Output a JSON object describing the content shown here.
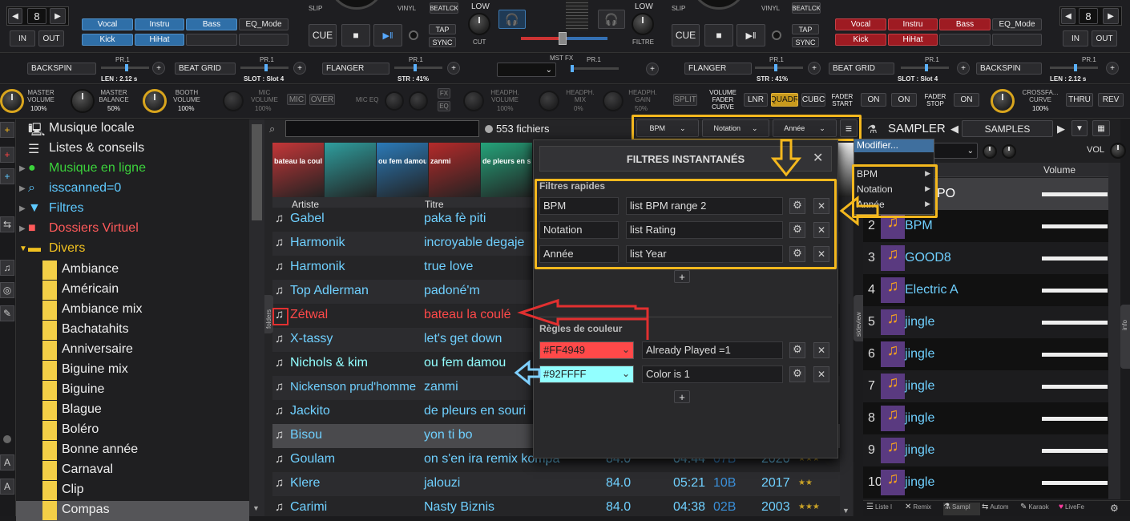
{
  "deck_left": {
    "loop": "8",
    "in": "IN",
    "out": "OUT",
    "pads": [
      "Vocal",
      "Instru",
      "Bass",
      "EQ_Mode",
      "Kick",
      "HiHat"
    ],
    "slip": "SLIP",
    "vinyl": "VINYL",
    "beatlock": "BEATLCK",
    "cue": "CUE",
    "tap": "TAP",
    "sync": "SYNC"
  },
  "deck_right": {
    "loop": "8",
    "in": "IN",
    "out": "OUT",
    "pads": [
      "Vocal",
      "Instru",
      "Bass",
      "EQ_Mode",
      "Kick",
      "HiHat"
    ],
    "slip": "SLIP",
    "vinyl": "VINYL",
    "beatlock": "BEATLCK",
    "cue": "CUE",
    "tap": "TAP",
    "sync": "SYNC"
  },
  "mixer": {
    "low": "LOW",
    "low_right": "LOW",
    "cut": "CUT",
    "filtre": "FILTRE"
  },
  "fx_row": {
    "l1_name": "BACKSPIN",
    "l1_pr": "PR.1",
    "l1_len": "LEN : 2.12 s",
    "l2_name": "BEAT GRID",
    "l2_pr": "PR.1",
    "l2_slot": "SLOT : Slot 4",
    "l3_name": "FLANGER",
    "l3_pr": "PR.1",
    "l3_str": "STR : 41%",
    "mst_fx": "MST FX",
    "mst_pr": "PR.1",
    "r1_name": "FLANGER",
    "r1_pr": "PR.1",
    "r1_str": "STR : 41%",
    "r2_name": "BEAT GRID",
    "r2_pr": "PR.1",
    "r2_slot": "SLOT : Slot 4",
    "r3_name": "BACKSPIN",
    "r3_pr": "PR.1",
    "r3_len": "LEN : 2.12 s"
  },
  "master_row": {
    "master_volume": "MASTER VOLUME",
    "master_volume_val": "100%",
    "master_balance": "MASTER BALANCE",
    "master_balance_val": "50%",
    "booth_volume": "BOOTH VOLUME",
    "booth_volume_val": "100%",
    "mic_volume": "MIC VOLUME",
    "mic_volume_val": "100%",
    "mic": "MIC",
    "over": "OVER",
    "mic_eq": "MIC EQ",
    "fx": "FX",
    "eq": "EQ",
    "headph_volume": "HEADPH. VOLUME",
    "headph_volume_val": "100%",
    "headph_mix": "HEADPH. MIX",
    "headph_mix_val": "0%",
    "headph_gain": "HEADPH. GAIN",
    "headph_gain_val": "50%",
    "split": "SPLIT",
    "volume_fader_curve": "VOLUME FADER CURVE",
    "lnr": "LNR",
    "quadr": "QUADR",
    "cubc": "CUBC",
    "fader_start": "FADER START",
    "on1": "ON",
    "on2": "ON",
    "fader_stop": "FADER STOP",
    "on3": "ON",
    "crossfader_curve": "CROSSFA... CURVE",
    "crossfader_val": "100%",
    "thru": "THRU",
    "rev": "REV"
  },
  "browser_tree": [
    {
      "label": "Musique locale",
      "color": "#e8e8e8"
    },
    {
      "label": "Listes & conseils",
      "color": "#e8e8e8"
    },
    {
      "label": "Musique en ligne",
      "color": "#3bd33b"
    },
    {
      "label": "isscanned=0",
      "color": "#5ec9ff"
    },
    {
      "label": "Filtres",
      "color": "#5ec9ff"
    },
    {
      "label": "Dossiers Virtuel",
      "color": "#ff5a5a"
    },
    {
      "label": "Divers",
      "color": "#f0c020"
    }
  ],
  "folders": [
    "Ambiance",
    "Américain",
    "Ambiance mix",
    "Bachatahits",
    "Anniversaire",
    "Biguine mix",
    "Biguine",
    "Blague",
    "Boléro",
    "Bonne année",
    "Carnaval",
    "Clip",
    "Compas"
  ],
  "search": {
    "value": "",
    "count": "553 fichiers"
  },
  "filter_dropdowns": [
    "BPM",
    "Notation",
    "Année"
  ],
  "covers": [
    "bateau la coulé",
    "",
    "ou fem damou",
    "zanmi",
    "de pleurs en sou"
  ],
  "track_columns": {
    "artist": "Artiste",
    "title": "Titre"
  },
  "tracks": [
    {
      "artist": "Gabel",
      "title": "paka fè piti",
      "bpm": "",
      "time": "",
      "key": "",
      "year": "",
      "stars": "",
      "color": "#6fd0ff"
    },
    {
      "artist": "Harmonik",
      "title": "incroyable degaje",
      "bpm": "",
      "time": "",
      "key": "",
      "year": "",
      "stars": "",
      "color": "#6fd0ff"
    },
    {
      "artist": "Harmonik",
      "title": "true love",
      "bpm": "",
      "time": "",
      "key": "",
      "year": "",
      "stars": "",
      "color": "#6fd0ff"
    },
    {
      "artist": "Top Adlerman",
      "title": "padoné'm",
      "bpm": "",
      "time": "",
      "key": "",
      "year": "",
      "stars": "",
      "color": "#6fd0ff"
    },
    {
      "artist": "Zétwal",
      "title": "bateau la coulé",
      "bpm": "",
      "time": "",
      "key": "",
      "year": "",
      "stars": "",
      "color": "#ff4949"
    },
    {
      "artist": "X-tassy",
      "title": "let's get down",
      "bpm": "",
      "time": "",
      "key": "",
      "year": "",
      "stars": "",
      "color": "#6fd0ff"
    },
    {
      "artist": "Nichols & kim",
      "title": "ou fem damou",
      "bpm": "",
      "time": "",
      "key": "",
      "year": "",
      "stars": "",
      "color": "#92ffff"
    },
    {
      "artist": "Nickenson prud'homme",
      "title": "zanmi",
      "bpm": "",
      "time": "",
      "key": "",
      "year": "",
      "stars": "",
      "color": "#6fd0ff"
    },
    {
      "artist": "Jackito",
      "title": "de pleurs en souri",
      "bpm": "",
      "time": "",
      "key": "",
      "year": "",
      "stars": "",
      "color": "#6fd0ff"
    },
    {
      "artist": "Bisou",
      "title": "yon ti bo",
      "bpm": "",
      "time": "",
      "key": "",
      "year": "",
      "stars": "",
      "color": "#6fd0ff"
    },
    {
      "artist": "Goulam",
      "title": "on s'en ira remix kompa",
      "bpm": "84.0",
      "time": "04:44",
      "key": "07B",
      "year": "2020",
      "stars": "★★★",
      "color": "#6fd0ff"
    },
    {
      "artist": "Klere",
      "title": "jalouzi",
      "bpm": "84.0",
      "time": "05:21",
      "key": "10B",
      "year": "2017",
      "stars": "★★",
      "color": "#6fd0ff"
    },
    {
      "artist": "Carimi",
      "title": "Nasty Biznis",
      "bpm": "84.0",
      "time": "04:38",
      "key": "02B",
      "year": "2003",
      "stars": "★★★",
      "color": "#6fd0ff"
    }
  ],
  "side_tabs": {
    "folders": "folders",
    "sideview": "sideview",
    "info": "info"
  },
  "dialog": {
    "title": "FILTRES INSTANTANÉS",
    "section_quick": "Filtres rapides",
    "quick": [
      {
        "name": "BPM",
        "value": "list BPM range 2"
      },
      {
        "name": "Notation",
        "value": "list Rating"
      },
      {
        "name": "Année",
        "value": "list Year"
      }
    ],
    "section_color": "Règles de couleur",
    "colors": [
      {
        "hex": "#FF4949",
        "rule": "Already Played =1",
        "bg": "#ff4949"
      },
      {
        "hex": "#92FFFF",
        "rule": "Color is 1",
        "bg": "#92ffff"
      }
    ],
    "add": "+"
  },
  "context_menu": {
    "top": "Modifier...",
    "items": [
      "BPM",
      "Notation",
      "Année"
    ]
  },
  "sampler": {
    "title": "SAMPLER",
    "bank": "SAMPLES",
    "vol": "VOL",
    "col_volume": "Volume",
    "slots": [
      {
        "num": "",
        "name": "PO",
        "color": "#ffffff"
      },
      {
        "num": "2",
        "name": "BPM",
        "color": "#6fd0ff"
      },
      {
        "num": "3",
        "name": "GOOD8",
        "color": "#6fd0ff"
      },
      {
        "num": "4",
        "name": "Electric A",
        "color": "#6fd0ff"
      },
      {
        "num": "5",
        "name": "jingle",
        "color": "#6fd0ff"
      },
      {
        "num": "6",
        "name": "jingle",
        "color": "#6fd0ff"
      },
      {
        "num": "7",
        "name": "jingle",
        "color": "#6fd0ff"
      },
      {
        "num": "8",
        "name": "jingle",
        "color": "#6fd0ff"
      },
      {
        "num": "9",
        "name": "jingle",
        "color": "#6fd0ff"
      },
      {
        "num": "10",
        "name": "jingle",
        "color": "#6fd0ff"
      }
    ]
  },
  "bottom_tabs": [
    "Liste l",
    "Remix",
    "Sampl",
    "Autom",
    "Karaok",
    "LiveFe"
  ],
  "colors": {
    "accent_yellow": "#f4b81e",
    "played_red": "#FF4949",
    "color_cyan": "#92FFFF",
    "link_blue": "#6fd0ff"
  }
}
